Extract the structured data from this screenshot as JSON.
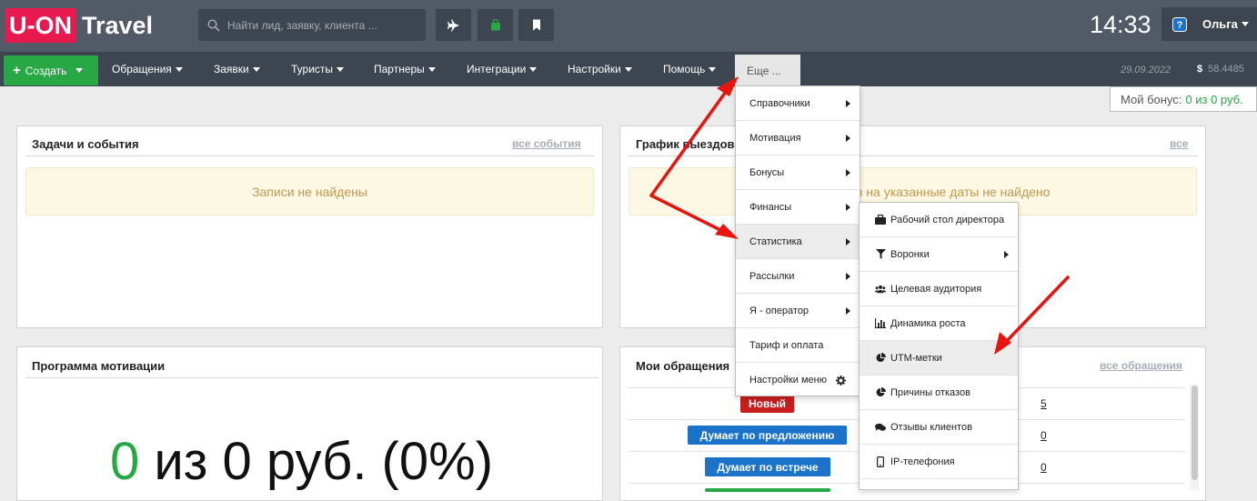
{
  "header": {
    "logo_left": "U-ON",
    "logo_right": "Travel",
    "search_placeholder": "Найти лид, заявку, клиента ...",
    "time": "14:33",
    "user_name": "Ольга"
  },
  "menubar": {
    "create_label": "Создать",
    "items": [
      {
        "label": "Обращения"
      },
      {
        "label": "Заявки"
      },
      {
        "label": "Туристы"
      },
      {
        "label": "Партнеры"
      },
      {
        "label": "Интеграции"
      },
      {
        "label": "Настройки"
      },
      {
        "label": "Помощь"
      }
    ],
    "more_label": "Еще ...",
    "date": "29.09.2022",
    "currency_symbol": "$",
    "currency_rate": "58.4485"
  },
  "bonus": {
    "label": "Мой бонус:",
    "value": "0 из 0 руб."
  },
  "panels": {
    "tasks": {
      "title": "Задачи и события",
      "link": "все события",
      "empty": "Записи не найдены"
    },
    "departures": {
      "title": "График выездов",
      "link": "все",
      "empty": "з на указанные даты не найдено"
    },
    "motivation": {
      "title": "Программа мотивации",
      "big_zero": "0",
      "big_rest": " из 0 руб. (0%)"
    },
    "requests": {
      "title": "Мои обращения",
      "link": "все обращения",
      "rows": [
        {
          "status": "Новый",
          "color": "#c91d1d",
          "count": "5"
        },
        {
          "status": "Думает по предложению",
          "color": "#1a73c8",
          "count": "0"
        },
        {
          "status": "Думает по встрече",
          "color": "#1a73c8",
          "count": "0"
        }
      ]
    }
  },
  "dropdown_more": {
    "items": [
      {
        "label": "Справочники",
        "submenu": true
      },
      {
        "label": "Мотивация",
        "submenu": true
      },
      {
        "label": "Бонусы",
        "submenu": true
      },
      {
        "label": "Финансы",
        "submenu": true
      },
      {
        "label": "Статистика",
        "submenu": true,
        "active": true
      },
      {
        "label": "Рассылки",
        "submenu": true
      },
      {
        "label": "Я - оператор",
        "submenu": true
      },
      {
        "label": "Тариф и оплата",
        "submenu": false
      },
      {
        "label": "Настройки меню",
        "submenu": false,
        "icon": "gear-icon"
      }
    ]
  },
  "dropdown_stats": {
    "items": [
      {
        "label": "Рабочий стол директора",
        "icon": "briefcase-icon"
      },
      {
        "label": "Воронки",
        "icon": "filter-icon",
        "submenu": true
      },
      {
        "label": "Целевая аудитория",
        "icon": "users-icon"
      },
      {
        "label": "Динамика роста",
        "icon": "bar-chart-icon"
      },
      {
        "label": "UTM-метки",
        "icon": "pie-chart-icon",
        "active": true
      },
      {
        "label": "Причины отказов",
        "icon": "pie-chart-icon"
      },
      {
        "label": "Отзывы клиентов",
        "icon": "comments-icon"
      },
      {
        "label": "IP-телефония",
        "icon": "phone-icon"
      }
    ]
  },
  "colors": {
    "accent_green": "#28a745",
    "brand_red": "#e8194f",
    "header_bg": "#515a66",
    "menubar_bg": "#3d4550",
    "annotation_arrow": "#e8140f"
  }
}
